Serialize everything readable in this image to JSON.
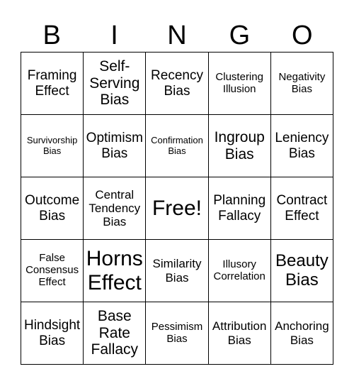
{
  "card": {
    "header": [
      "B",
      "I",
      "N",
      "G",
      "O"
    ],
    "rows": [
      [
        {
          "text": "Framing\nEffect"
        },
        {
          "text": "Self-\nServing\nBias"
        },
        {
          "text": "Recency\nBias"
        },
        {
          "text": "Clustering\nIllusion"
        },
        {
          "text": "Negativity\nBias"
        }
      ],
      [
        {
          "text": "Survivorship\nBias"
        },
        {
          "text": "Optimism\nBias"
        },
        {
          "text": "Confirmation\nBias"
        },
        {
          "text": "Ingroup\nBias"
        },
        {
          "text": "Leniency\nBias"
        }
      ],
      [
        {
          "text": "Outcome\nBias"
        },
        {
          "text": "Central\nTendency\nBias"
        },
        {
          "text": "Free!",
          "free": true
        },
        {
          "text": "Planning\nFallacy"
        },
        {
          "text": "Contract\nEffect"
        }
      ],
      [
        {
          "text": "False\nConsensus\nEffect"
        },
        {
          "text": "Horns\nEffect"
        },
        {
          "text": "Similarity\nBias"
        },
        {
          "text": "Illusory\nCorrelation"
        },
        {
          "text": "Beauty\nBias"
        }
      ],
      [
        {
          "text": "Hindsight\nBias"
        },
        {
          "text": "Base\nRate\nFallacy"
        },
        {
          "text": "Pessimism\nBias"
        },
        {
          "text": "Attribution\nBias"
        },
        {
          "text": "Anchoring\nBias"
        }
      ]
    ]
  }
}
